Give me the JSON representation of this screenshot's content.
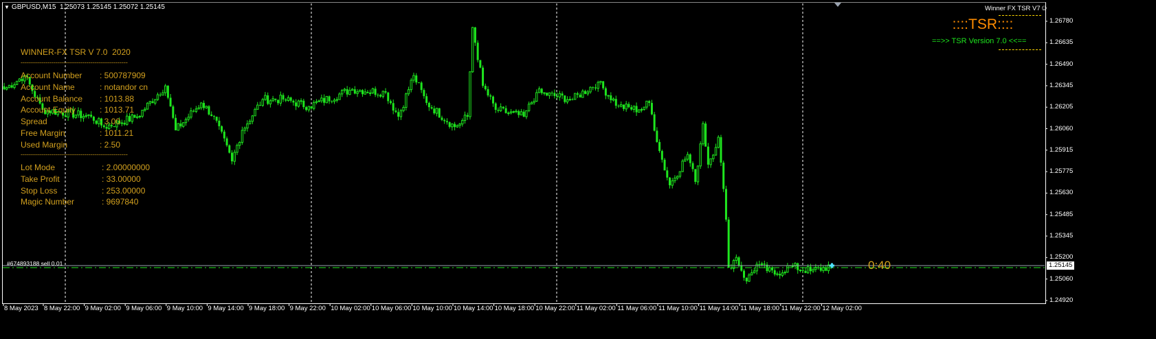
{
  "header": {
    "symbol": "GBPUSD,M15",
    "ohlc": "1.25073 1.25145 1.25072 1.25145"
  },
  "panel": {
    "title": "WINNER-FX TSR V 7.0  2020",
    "divider": "----------------------------------------------------",
    "rows": [
      {
        "label": "Account Number",
        "value": ": 500787909"
      },
      {
        "label": "Account Name",
        "value": ": notandor cn"
      },
      {
        "label": "Account Balance",
        "value": ": 1013.88"
      },
      {
        "label": "Account Equity",
        "value": ": 1013.71"
      },
      {
        "label": "Spread",
        "value": ": 3.00"
      },
      {
        "label": "Free Margin",
        "value": ": 1011.21"
      },
      {
        "label": "Used Margin",
        "value": ": 2.50"
      }
    ],
    "settings": [
      {
        "label": "Lot Mode",
        "value": ": 2.00000000"
      },
      {
        "label": "Take Profit",
        "value": ": 33.00000"
      },
      {
        "label": "Stop Loss",
        "value": ": 253.00000"
      },
      {
        "label": "Magic Number",
        "value": ": 9697840"
      }
    ]
  },
  "top_right": {
    "title": "Winner FX TSR V7",
    "smiley": "☺",
    "logo": "::::TSR::::",
    "version": "==>> TSR Version 7.0 <<=="
  },
  "order_label": "#674893188 sell 0.01",
  "bar_timer": "0:40",
  "current_price": "1.25145",
  "colors": {
    "candle": "#1ee61e",
    "panel_text": "#d2a01e",
    "order_line": "#9aa3b0",
    "sl_line": "#1ee61e"
  },
  "price_axis": [
    "1.26780",
    "1.26635",
    "1.26490",
    "1.26345",
    "1.26205",
    "1.26060",
    "1.25915",
    "1.25775",
    "1.25630",
    "1.25485",
    "1.25345",
    "1.25200",
    "1.25060",
    "1.24920"
  ],
  "time_axis": [
    "8 May 2023",
    "8 May 22:00",
    "9 May 02:00",
    "9 May 06:00",
    "9 May 10:00",
    "9 May 14:00",
    "9 May 18:00",
    "9 May 22:00",
    "10 May 02:00",
    "10 May 06:00",
    "10 May 10:00",
    "10 May 14:00",
    "10 May 18:00",
    "10 May 22:00",
    "11 May 02:00",
    "11 May 06:00",
    "11 May 10:00",
    "11 May 14:00",
    "11 May 18:00",
    "11 May 22:00",
    "12 May 02:00"
  ],
  "chart_data": {
    "type": "candlestick",
    "timeframe": "M15",
    "ylim": [
      1.2492,
      1.2678
    ],
    "close_anchors": [
      [
        0,
        1.26326
      ],
      [
        8,
        1.26418
      ],
      [
        15,
        1.26189
      ],
      [
        34,
        1.26143
      ],
      [
        39,
        1.26074
      ],
      [
        52,
        1.26143
      ],
      [
        63,
        1.26349
      ],
      [
        67,
        1.26052
      ],
      [
        77,
        1.26235
      ],
      [
        82,
        1.26143
      ],
      [
        89,
        1.25845
      ],
      [
        93,
        1.26052
      ],
      [
        101,
        1.26258
      ],
      [
        109,
        1.26258
      ],
      [
        119,
        1.26212
      ],
      [
        136,
        1.26326
      ],
      [
        149,
        1.26304
      ],
      [
        154,
        1.26143
      ],
      [
        160,
        1.26418
      ],
      [
        165,
        1.26235
      ],
      [
        176,
        1.26074
      ],
      [
        181,
        1.26143
      ],
      [
        183,
        1.26739
      ],
      [
        187,
        1.26349
      ],
      [
        192,
        1.26189
      ],
      [
        203,
        1.26143
      ],
      [
        208,
        1.26304
      ],
      [
        222,
        1.26258
      ],
      [
        232,
        1.26372
      ],
      [
        240,
        1.26212
      ],
      [
        248,
        1.26189
      ],
      [
        252,
        1.26235
      ],
      [
        256,
        1.25914
      ],
      [
        260,
        1.25685
      ],
      [
        267,
        1.25891
      ],
      [
        270,
        1.25708
      ],
      [
        273,
        1.26097
      ],
      [
        275,
        1.25823
      ],
      [
        279,
        1.26006
      ],
      [
        282,
        1.25456
      ],
      [
        283,
        1.25135
      ],
      [
        286,
        1.25204
      ],
      [
        290,
        1.25044
      ],
      [
        294,
        1.25158
      ],
      [
        301,
        1.2509
      ],
      [
        307,
        1.25145
      ],
      [
        315,
        1.25112
      ],
      [
        323,
        1.25145
      ]
    ]
  }
}
